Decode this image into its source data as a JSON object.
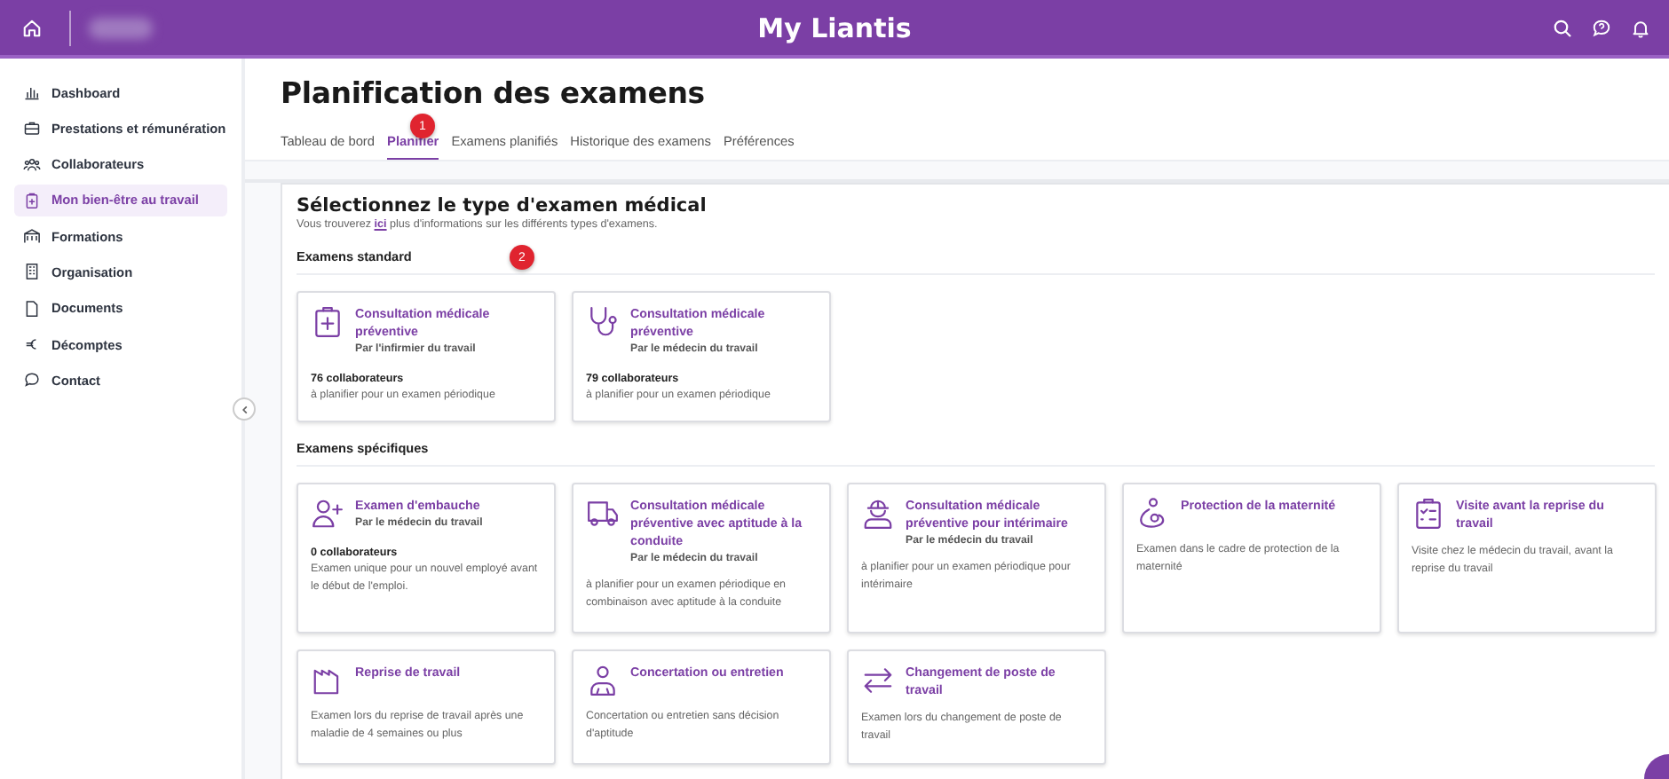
{
  "header": {
    "title": "My Liantis"
  },
  "sidebar": {
    "items": [
      {
        "label": "Dashboard",
        "selected": false
      },
      {
        "label": "Prestations et rémunération",
        "selected": false
      },
      {
        "label": "Collaborateurs",
        "selected": false
      },
      {
        "label": "Mon bien-être au travail",
        "selected": true
      },
      {
        "label": "Formations",
        "selected": false
      },
      {
        "label": "Organisation",
        "selected": false
      },
      {
        "label": "Documents",
        "selected": false
      },
      {
        "label": "Décomptes",
        "selected": false
      },
      {
        "label": "Contact",
        "selected": false
      }
    ]
  },
  "page": {
    "title": "Planification des examens",
    "tabs": [
      {
        "label": "Tableau de bord",
        "selected": false
      },
      {
        "label": "Planifier",
        "selected": true
      },
      {
        "label": "Examens planifiés",
        "selected": false
      },
      {
        "label": "Historique des examens",
        "selected": false
      },
      {
        "label": "Préférences",
        "selected": false
      }
    ],
    "markers": [
      "1",
      "2"
    ]
  },
  "panel": {
    "title": "Sélectionnez le type d'examen médical",
    "intro_before": "Vous trouverez",
    "intro_link": "ici",
    "intro_after": "plus d'informations sur les différents types d'examens.",
    "sections": [
      {
        "title": "Examens standard",
        "cards": [
          {
            "title": "Consultation médicale préventive",
            "subtitle": "Par l'infirmier du travail",
            "count": "76 collaborateurs",
            "description": "à planifier pour un examen périodique"
          },
          {
            "title": "Consultation médicale préventive",
            "subtitle": "Par le médecin du travail",
            "count": "79 collaborateurs",
            "description": "à planifier pour un examen périodique"
          }
        ]
      },
      {
        "title": "Examens spécifiques",
        "cards": [
          {
            "title": "Examen d'embauche",
            "subtitle": "Par le médecin du travail",
            "count": "0 collaborateurs",
            "description": "Examen unique pour un nouvel employé avant le début de l'emploi."
          },
          {
            "title": "Consultation médicale préventive avec aptitude à la conduite",
            "subtitle": "Par le médecin du travail",
            "description": "à planifier pour un examen périodique en combinaison avec aptitude à la conduite"
          },
          {
            "title": "Consultation médicale préventive pour intérimaire",
            "subtitle": "Par le médecin du travail",
            "description": "à planifier pour un examen périodique pour intérimaire"
          },
          {
            "title": "Protection de la maternité",
            "description": "Examen dans le cadre de protection de la maternité"
          },
          {
            "title": "Visite avant la reprise du travail",
            "description": "Visite chez le médecin du travail, avant la reprise du travail"
          },
          {
            "title": "Reprise de travail",
            "description": "Examen lors du reprise de travail après une maladie de 4 semaines ou plus"
          },
          {
            "title": "Concertation ou entretien",
            "description": "Concertation ou entretien sans décision d'aptitude"
          },
          {
            "title": "Changement de poste de travail",
            "description": "Examen lors du changement de poste de travail"
          }
        ]
      }
    ]
  }
}
